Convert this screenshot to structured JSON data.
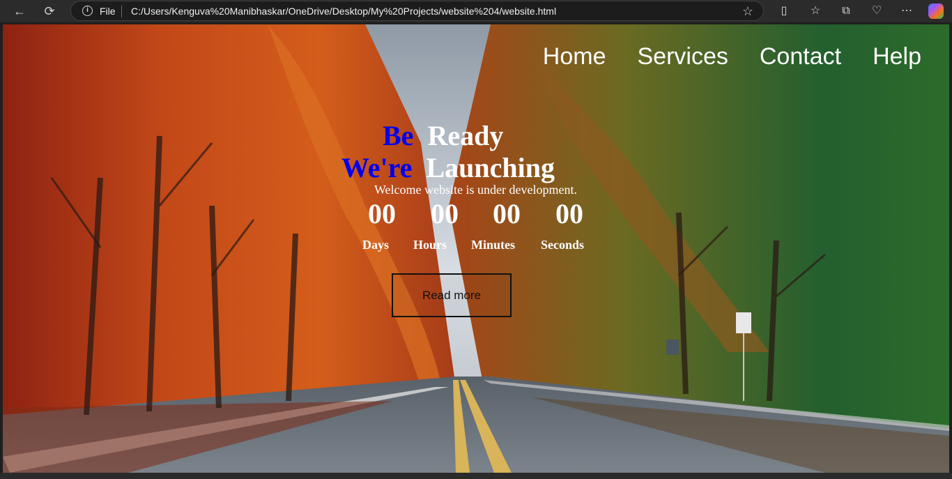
{
  "browser": {
    "address_scheme_label": "File",
    "url": "C:/Users/Kenguva%20Manibhaskar/OneDrive/Desktop/My%20Projects/website%204/website.html",
    "icons": [
      "back-icon",
      "refresh-icon",
      "info-icon",
      "favorite-star-icon",
      "split-screen-icon",
      "favorites-icon",
      "collections-icon",
      "health-icon",
      "more-icon",
      "copilot-icon"
    ]
  },
  "site": {
    "nav": [
      "Home",
      "Services",
      "Contact",
      "Help"
    ],
    "headline_line1": {
      "blue": "Be",
      "white": "Ready"
    },
    "headline_line2": {
      "blue": "We're",
      "white": "Launching"
    },
    "subtitle": "Welcome website is under development.",
    "countdown": [
      {
        "value": "00",
        "label": "Days"
      },
      {
        "value": "00",
        "label": "Hours"
      },
      {
        "value": "00",
        "label": "Minutes"
      },
      {
        "value": "00",
        "label": "Seconds"
      }
    ],
    "button": "Read more"
  },
  "colors": {
    "accent_blue": "#0000ee",
    "text_white": "#ffffff"
  }
}
